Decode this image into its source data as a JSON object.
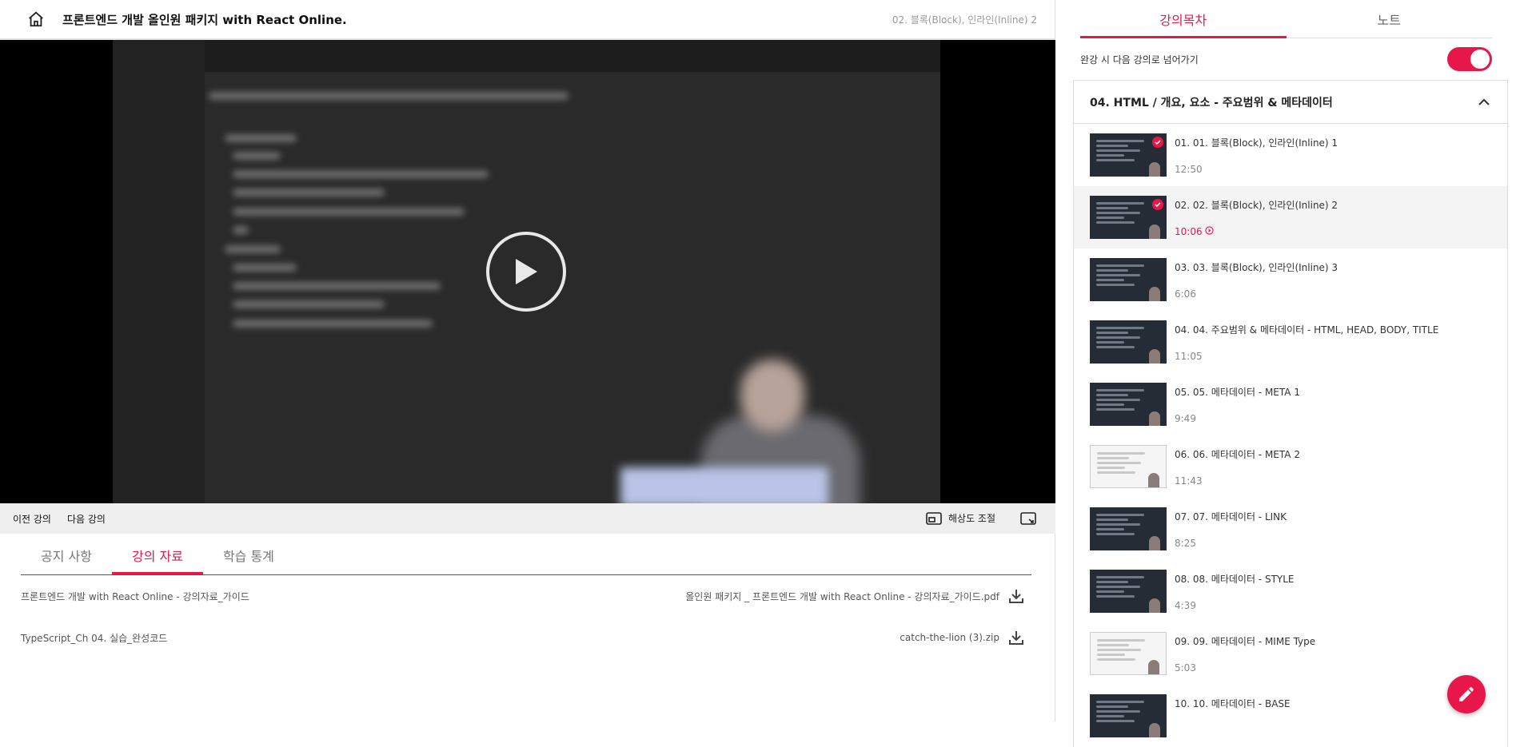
{
  "header": {
    "course_title": "프론트엔드 개발 올인원 패키지 with React Online.",
    "current_lecture": "02. 블록(Block), 인라인(Inline) 2"
  },
  "controls": {
    "prev": "이전 강의",
    "next": "다음 강의",
    "resolution": "해상도 조절"
  },
  "tabs": [
    "공지 사항",
    "강의 자료",
    "학습 통계"
  ],
  "materials": [
    {
      "name": "프론트엔드 개발 with React Online - 강의자료_가이드",
      "file": "올인원 패키지 _ 프론트엔드 개발 with React Online - 강의자료_가이드.pdf"
    },
    {
      "name": "TypeScript_Ch 04. 실습_완성코드",
      "file": "catch-the-lion (3).zip"
    }
  ],
  "sidebar": {
    "tabs": [
      "강의목차",
      "노트"
    ],
    "autoplay_label": "완강 시 다음 강의로 넘어가기",
    "autoplay_on": true,
    "section_title": "04. HTML / 개요, 요소 - 주요범위 & 메타데이터",
    "items": [
      {
        "title": "01. 01. 블록(Block), 인라인(Inline) 1",
        "duration": "12:50"
      },
      {
        "title": "02. 02. 블록(Block), 인라인(Inline) 2",
        "duration": "10:06"
      },
      {
        "title": "03. 03. 블록(Block), 인라인(Inline) 3",
        "duration": "6:06"
      },
      {
        "title": "04. 04. 주요범위 & 메타데이터 - HTML, HEAD, BODY, TITLE",
        "duration": "11:05"
      },
      {
        "title": "05. 05. 메타데이터 - META 1",
        "duration": "9:49"
      },
      {
        "title": "06. 06. 메타데이터 - META 2",
        "duration": "11:43"
      },
      {
        "title": "07. 07. 메타데이터 - LINK",
        "duration": "8:25"
      },
      {
        "title": "08. 08. 메타데이터 - STYLE",
        "duration": "4:39"
      },
      {
        "title": "09. 09. 메타데이터 - MIME Type",
        "duration": "5:03"
      },
      {
        "title": "10. 10. 메타데이터 - BASE",
        "duration": ""
      }
    ]
  },
  "colors": {
    "accent": "#e8174a"
  }
}
